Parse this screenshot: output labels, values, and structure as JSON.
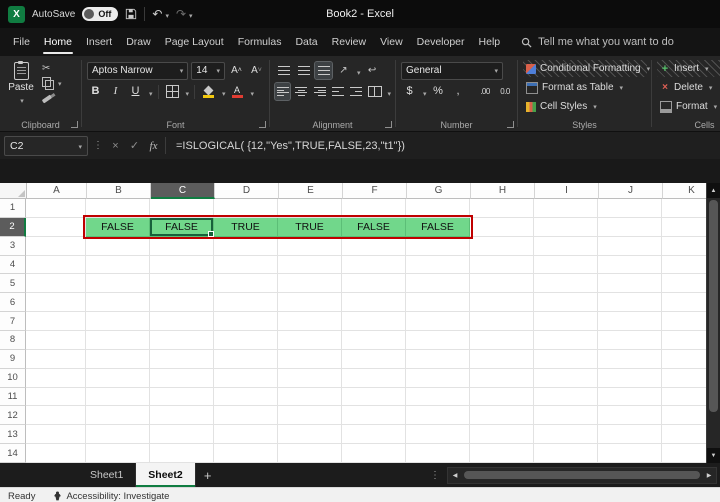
{
  "colors": {
    "accent": "#107c41",
    "fill_green": "#71d78b",
    "range_border": "#c00000"
  },
  "icons": {
    "dropdown": "▾",
    "undo": "↶",
    "redo": "↷",
    "scissors": "✂",
    "more": "⋮",
    "cancel": "×",
    "check": "✓",
    "fx": "fx",
    "up": "▲",
    "down": "▼",
    "left": "◀",
    "right": "▶",
    "plus": "+",
    "wrap": "↩",
    "orientation": "↗",
    "dollar": "$",
    "percent": "%",
    "comma": ",",
    "increase_decimal": ".00",
    "decrease_decimal": "0.0"
  },
  "titlebar": {
    "app_logo_letter": "X",
    "autosave_label": "AutoSave",
    "autosave_state": "Off",
    "title": "Book2  -  Excel"
  },
  "menu": {
    "tabs": [
      "File",
      "Home",
      "Insert",
      "Draw",
      "Page Layout",
      "Formulas",
      "Data",
      "Review",
      "View",
      "Developer",
      "Help"
    ],
    "active": "Home",
    "search": "Tell me what you want to do"
  },
  "ribbon": {
    "paste_label": "Paste",
    "font_name": "Aptos Narrow",
    "font_size": "14",
    "bold": "B",
    "italic": "I",
    "underline": "U",
    "number_format": "General",
    "styles_items": [
      "Conditional Formatting",
      "Format as Table",
      "Cell Styles"
    ],
    "cells_items": [
      "Insert",
      "Delete",
      "Format"
    ],
    "group_labels": [
      "Clipboard",
      "Font",
      "Alignment",
      "Number",
      "Styles",
      "Cells"
    ]
  },
  "formula_bar": {
    "name_box": "C2",
    "formula": "=ISLOGICAL( {12,\"Yes\",TRUE,FALSE,23,\"t1\"})"
  },
  "grid": {
    "columns": [
      "A",
      "B",
      "C",
      "D",
      "E",
      "F",
      "G",
      "H",
      "I",
      "J",
      "K"
    ],
    "rows": 14,
    "selected": {
      "col": "C",
      "row": 2
    },
    "row2_values": [
      {
        "col": "B",
        "value": "FALSE"
      },
      {
        "col": "C",
        "value": "FALSE"
      },
      {
        "col": "D",
        "value": "TRUE"
      },
      {
        "col": "E",
        "value": "TRUE"
      },
      {
        "col": "F",
        "value": "FALSE"
      },
      {
        "col": "G",
        "value": "FALSE"
      }
    ]
  },
  "sheets": {
    "tabs": [
      "Sheet1",
      "Sheet2"
    ],
    "active": "Sheet2"
  },
  "status": {
    "ready": "Ready",
    "accessibility": "Accessibility: Investigate"
  }
}
